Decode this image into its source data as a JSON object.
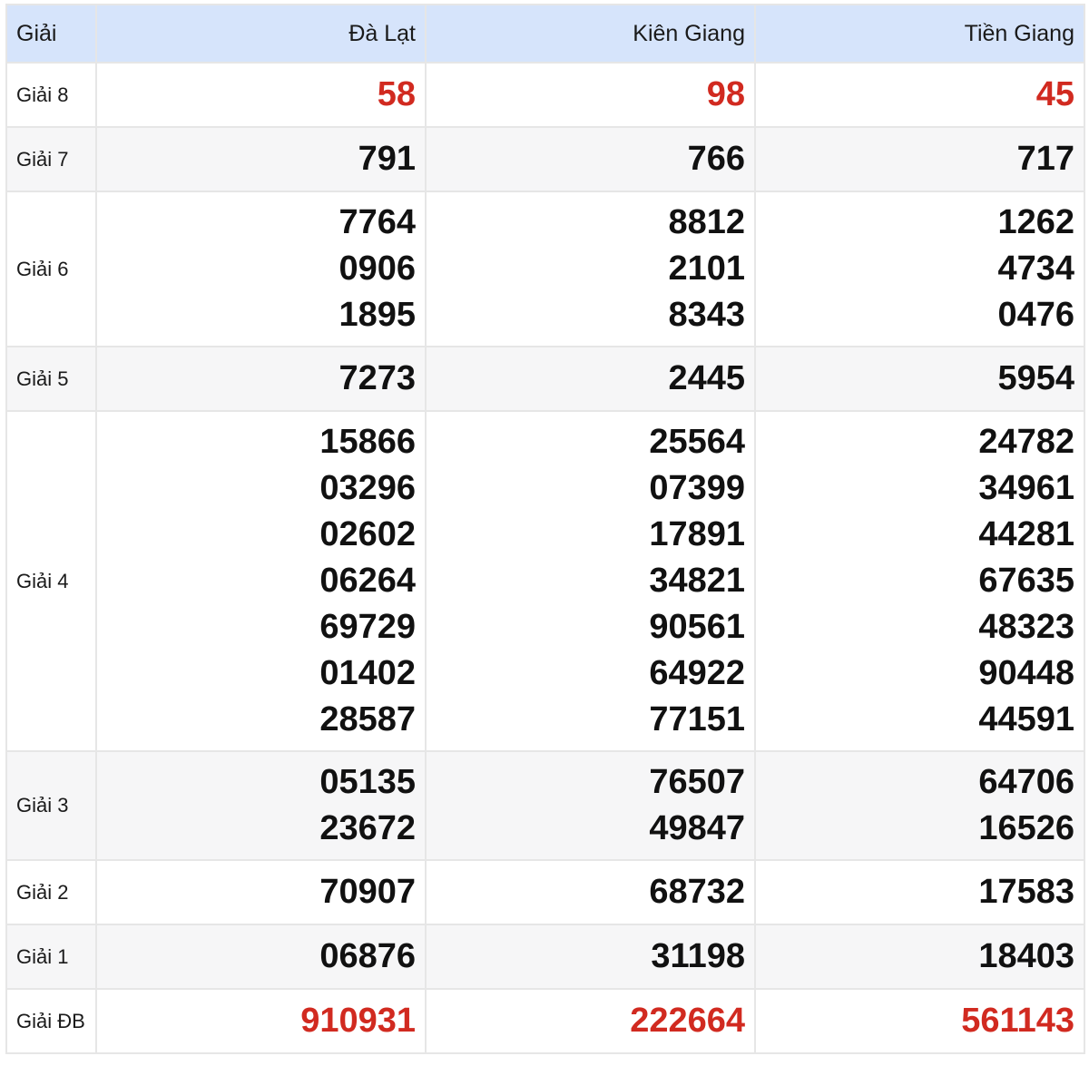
{
  "header": {
    "col0": "Giải",
    "provinces": [
      "Đà Lạt",
      "Kiên Giang",
      "Tiền Giang"
    ]
  },
  "colors": {
    "header_bg": "#d6e4fb",
    "highlight": "#d12a20",
    "alt_row_bg": "#f6f6f7"
  },
  "prizes": [
    {
      "label": "Giải 8",
      "highlight": true,
      "values": [
        [
          "58"
        ],
        [
          "98"
        ],
        [
          "45"
        ]
      ]
    },
    {
      "label": "Giải 7",
      "values": [
        [
          "791"
        ],
        [
          "766"
        ],
        [
          "717"
        ]
      ]
    },
    {
      "label": "Giải 6",
      "values": [
        [
          "7764",
          "0906",
          "1895"
        ],
        [
          "8812",
          "2101",
          "8343"
        ],
        [
          "1262",
          "4734",
          "0476"
        ]
      ]
    },
    {
      "label": "Giải 5",
      "values": [
        [
          "7273"
        ],
        [
          "2445"
        ],
        [
          "5954"
        ]
      ]
    },
    {
      "label": "Giải 4",
      "values": [
        [
          "15866",
          "03296",
          "02602",
          "06264",
          "69729",
          "01402",
          "28587"
        ],
        [
          "25564",
          "07399",
          "17891",
          "34821",
          "90561",
          "64922",
          "77151"
        ],
        [
          "24782",
          "34961",
          "44281",
          "67635",
          "48323",
          "90448",
          "44591"
        ]
      ]
    },
    {
      "label": "Giải 3",
      "values": [
        [
          "05135",
          "23672"
        ],
        [
          "76507",
          "49847"
        ],
        [
          "64706",
          "16526"
        ]
      ]
    },
    {
      "label": "Giải 2",
      "values": [
        [
          "70907"
        ],
        [
          "68732"
        ],
        [
          "17583"
        ]
      ]
    },
    {
      "label": "Giải 1",
      "values": [
        [
          "06876"
        ],
        [
          "31198"
        ],
        [
          "18403"
        ]
      ]
    },
    {
      "label": "Giải ĐB",
      "highlight": true,
      "values": [
        [
          "910931"
        ],
        [
          "222664"
        ],
        [
          "561143"
        ]
      ]
    }
  ]
}
